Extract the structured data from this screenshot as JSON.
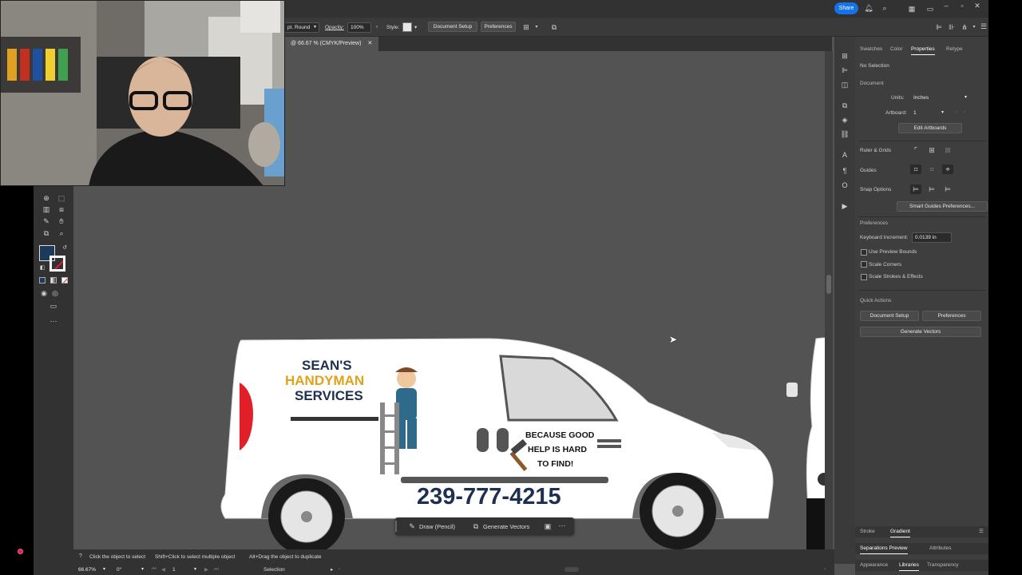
{
  "app": {
    "share_label": "Share",
    "doc_tab_title": "@ 66.67 % (CMYK/Preview)"
  },
  "control_bar": {
    "stroke_profile": "pt. Round",
    "opacity_label": "Opacity:",
    "opacity_value": "100%",
    "style_label": "Style:",
    "document_setup": "Document Setup",
    "preferences": "Preferences"
  },
  "panel": {
    "tabs": [
      "Swatches",
      "Color",
      "Properties",
      "Retype"
    ],
    "active_tab": "Properties",
    "no_selection": "No Selection",
    "document_header": "Document",
    "units_label": "Units:",
    "units_value": "Inches",
    "artboard_label": "Artboard:",
    "artboard_value": "1",
    "edit_artboards": "Edit Artboards",
    "ruler_grids": "Ruler & Grids",
    "guides": "Guides",
    "snap_options": "Snap Options",
    "smart_guides_prefs": "Smart Guides Preferences...",
    "preferences_header": "Preferences",
    "keyboard_increment_label": "Keyboard Increment:",
    "keyboard_increment_value": "0.0139 in",
    "use_preview_bounds": "Use Preview Bounds",
    "scale_corners": "Scale Corners",
    "scale_strokes": "Scale Strokes & Effects",
    "quick_actions": "Quick Actions",
    "qa_document_setup": "Document Setup",
    "qa_preferences": "Preferences",
    "qa_generate_vectors": "Generate Vectors",
    "bottom_tabs_1": [
      "Stroke",
      "Gradient"
    ],
    "bottom_tabs_2": [
      "Separations Preview",
      "Attributes"
    ],
    "bottom_tabs_3": [
      "Appearance",
      "Libraries",
      "Transparency"
    ]
  },
  "context_bar": {
    "draw_label": "Draw (Pencil)",
    "generate_vectors": "Generate Vectors"
  },
  "status": {
    "hint_1": "Click the object to select",
    "hint_2": "Shift+Click to select multiple object",
    "hint_3": "Alt+Drag the object to duplicate",
    "zoom": "66.67%",
    "rotation": "0°",
    "artboard": "1",
    "tool": "Selection"
  },
  "artwork": {
    "brand_line1": "SEAN'S",
    "brand_line2": "HANDYMAN",
    "brand_line3": "SERVICES",
    "tagline_1": "BECAUSE GOOD",
    "tagline_2": "HELP IS HARD",
    "tagline_3": "TO FIND!",
    "phone": "239-777-4215"
  },
  "colors": {
    "accent": "#1473e6",
    "brand_gold": "#e0a21a",
    "brand_navy": "#1e2f4f",
    "fill_swatch": "#1d3a5c",
    "van_red": "#e01f26"
  }
}
